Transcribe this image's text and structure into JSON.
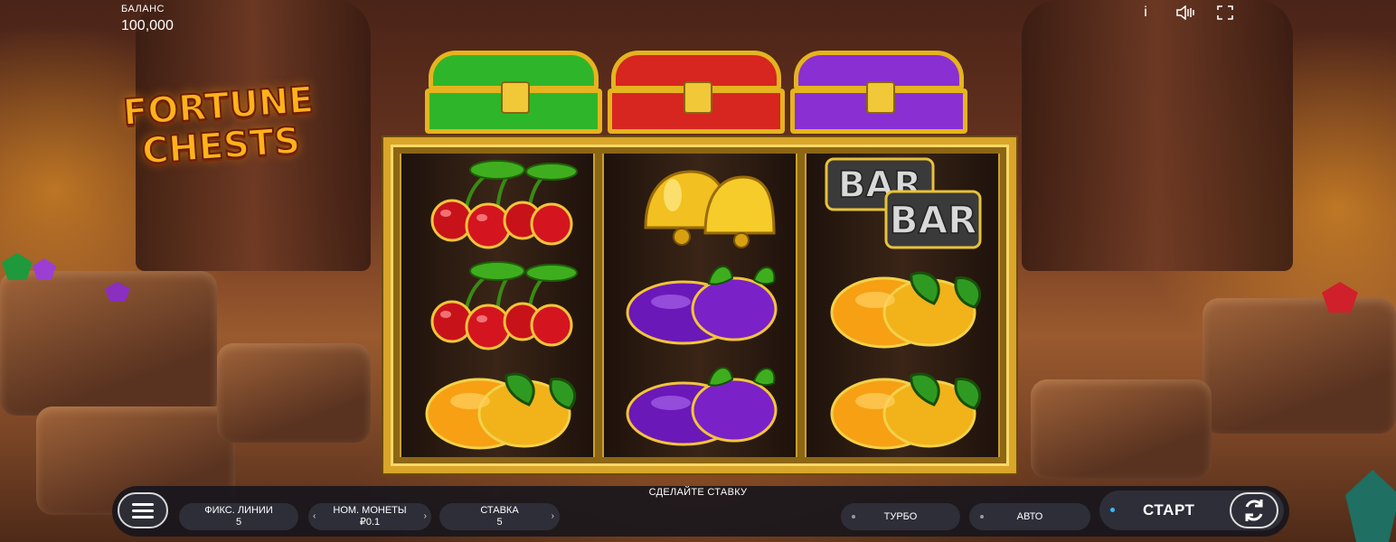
{
  "balance": {
    "label": "БАЛАНС",
    "value": "100,000"
  },
  "top_icons": [
    "info-icon",
    "sound-icon",
    "fullscreen-icon"
  ],
  "top_icon_glyphs": {
    "info": "i",
    "sound": "◁⦀",
    "fullscreen": "⛶"
  },
  "logo": {
    "line1": "FORTUNE",
    "line2": "CHESTS"
  },
  "chests": [
    {
      "color": "#2fb52a"
    },
    {
      "color": "#d6261f"
    },
    {
      "color": "#8a2fd1"
    }
  ],
  "reels": [
    [
      "cherry",
      "cherry",
      "orange"
    ],
    [
      "bell",
      "plum",
      "plum"
    ],
    [
      "bar",
      "orange",
      "orange"
    ]
  ],
  "bar_text": "BAR",
  "controls": {
    "message": "СДЕЛАЙТЕ СТАВКУ",
    "lines_label": "ФИКС. ЛИНИИ",
    "lines_value": "5",
    "coin_label": "НОМ. МОНЕТЫ",
    "coin_value": "₽0.1",
    "bet_label": "СТАВКА",
    "bet_value": "5",
    "turbo_label": "ТУРБО",
    "auto_label": "АВТО",
    "start_label": "СТАРТ"
  }
}
